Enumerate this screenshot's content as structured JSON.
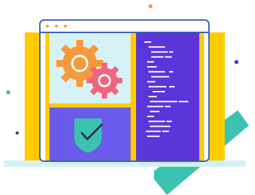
{
  "colors": {
    "frame_yellow": "#FFCC00",
    "window_outline": "#3A5BB8",
    "browser_dots": "#F2A23A",
    "panel_light_blue": "#D7F2F7",
    "panel_purple": "#6B5BEA",
    "code_panel": "#5B35D9",
    "code_lines": "#FFFFFF",
    "teal_ramp": "#3CC2B0",
    "shield_teal": "#3CC2B0",
    "check_dark": "#2C2B57",
    "gear_orange": "#F59A3B",
    "gear_pink": "#F06580",
    "base_shelf": "#D2F1F6",
    "accent_dot_orange": "#F2A23A",
    "accent_dot_teal": "#3CC2B0",
    "accent_dot_purple": "#5B35D9",
    "accent_dot_navy": "#2F4CA6"
  },
  "icons": [
    "settings-gears-icon",
    "shield-check-icon",
    "code-lines-icon",
    "browser-dots-icon"
  ]
}
